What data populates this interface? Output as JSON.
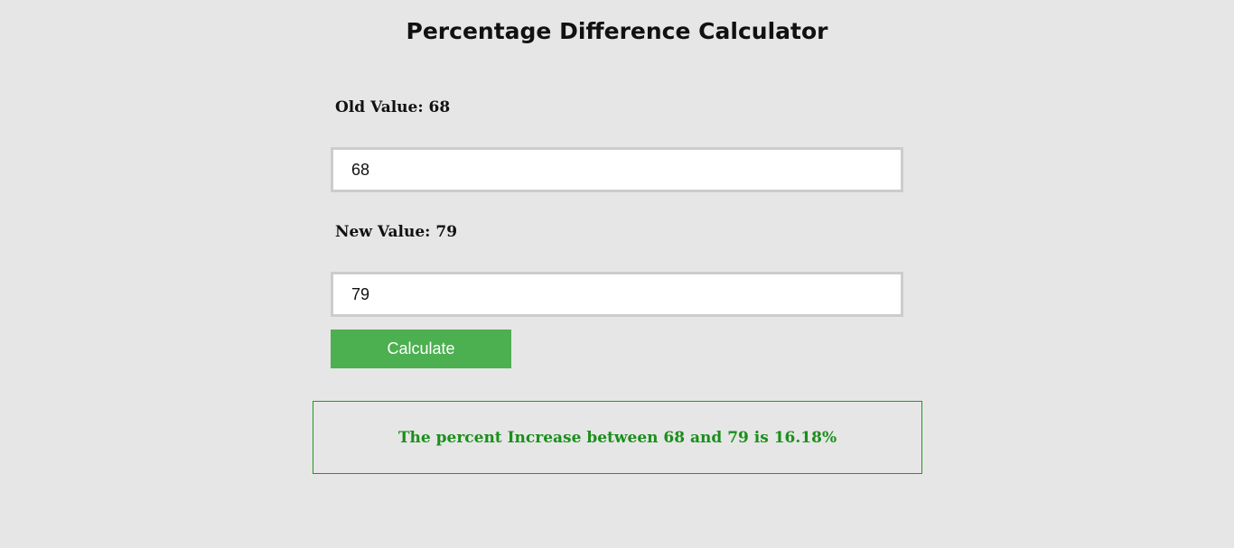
{
  "page": {
    "title": "Percentage Difference Calculator"
  },
  "form": {
    "old_label": "Old Value: 68",
    "old_value": "68",
    "new_label": "New Value: 79",
    "new_value": "79",
    "calculate_label": "Calculate"
  },
  "result": {
    "text": "The percent Increase between 68 and 79 is 16.18%"
  },
  "colors": {
    "background": "#e6e6e6",
    "button": "#4caf50",
    "result_text": "#1a8f1a",
    "result_border": "#1f9a1f"
  }
}
